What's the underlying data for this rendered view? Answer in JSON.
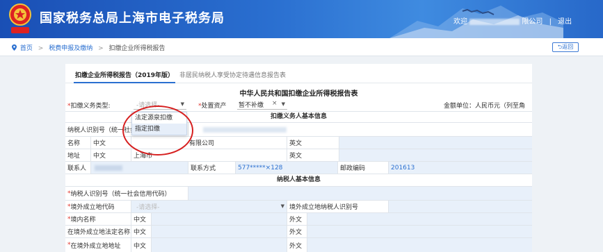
{
  "header": {
    "title": "国家税务总局上海市电子税务局",
    "welcome": "欢迎",
    "company_suffix": "限公司",
    "logout": "退出"
  },
  "breadcrumb": {
    "home": "首页",
    "level1": "税费申报及缴纳",
    "current": "扣缴企业所得税报告",
    "back": "返回"
  },
  "tabs": {
    "active": "扣缴企业所得税报告（2019年版）",
    "other": "非居民纳税人享受协定待遇信息报告表"
  },
  "form": {
    "title": "中华人民共和国扣缴企业所得税报告表",
    "withhold_type_label": "扣缴义务类型:",
    "withhold_type_placeholder": "-请选择-",
    "disposal_label": "处置资产",
    "disposal_value": "暂不补缴",
    "amount_unit": "金额单位：人民币元（列至角分）"
  },
  "dropdown": {
    "options": [
      "法定源泉扣缴",
      "指定扣缴"
    ]
  },
  "agent_section": {
    "title": "扣缴义务人基本信息",
    "taxpayer_id_label": "纳税人识别号（统一社会信",
    "name_label": "名称",
    "cn": "中文",
    "name_value_suffix": "有限公司",
    "en": "英文",
    "address_label": "地址",
    "address_value": "上海市",
    "contact_label": "联系人",
    "phone_label": "联系方式",
    "phone_value": "577*****×128",
    "postcode_label": "邮政编码",
    "postcode_value": "201613"
  },
  "taxpayer_section": {
    "title": "纳税人基本信息",
    "taxpayer_id_label": "纳税人识别号（统一社会信用代码）",
    "foreign_region_label": "境外成立地代码",
    "foreign_region_placeholder": "-请选择-",
    "foreign_taxid_label": "境外成立地纳税人识别号",
    "domestic_name_label": "境内名称",
    "cn": "中文",
    "en": "外文",
    "foreign_legal_name_label": "在境外成立地法定名称",
    "foreign_address_label": "在境外成立地地址"
  },
  "colors": {
    "header_blue": "#1a4fb5",
    "link_blue": "#2a6fd0",
    "required_red": "#e0322b",
    "annotation_red": "#d61f1f"
  }
}
